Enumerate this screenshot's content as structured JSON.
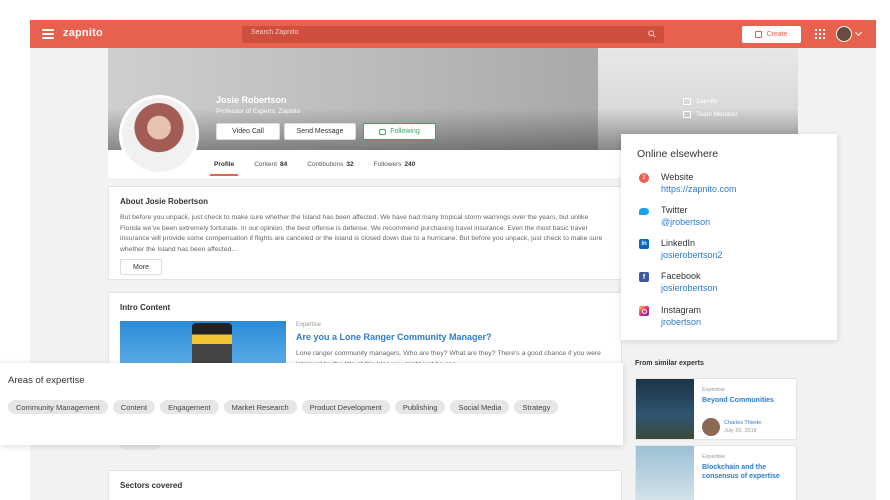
{
  "topbar": {
    "logo": "zapnito",
    "search_placeholder": "Search Zapnito",
    "create_label": "Create",
    "accent": "#e8614e"
  },
  "profile": {
    "name": "Josie Robertson",
    "title": "Professor of Experts, Zapnito",
    "buttons": {
      "video": "Video Call",
      "message": "Send Message",
      "following": "Following"
    },
    "side_info": [
      "Zapnito",
      "Team Member"
    ]
  },
  "tabs": [
    {
      "label": "Profile",
      "count": ""
    },
    {
      "label": "Content",
      "count": "84"
    },
    {
      "label": "Contibutions",
      "count": "32"
    },
    {
      "label": "Followers",
      "count": "240"
    }
  ],
  "about": {
    "title": "About Josie Robertson",
    "text": "But before you unpack, just check to make sure whether the Island has been affected. We have had many tropical storm warnings over the years, but unlike Florida we’ve been extremely fortunate. In our opinion, the best offense is defense. We recommend purchasing travel insurance. Even the most basic travel insurance will provide some compensation if flights are canceled or the island is closed down due to a hurricane. But before you unpack, just check to make sure whether the Island has been affected…",
    "more_label": "More"
  },
  "intro": {
    "title": "Intro Content",
    "kicker": "Expertise",
    "headline": "Are you a Lone Ranger Community Manager?",
    "text": "Lone ranger community managers. Who are they? What are they? There's a good chance if you were intrigued by the title of this blog you might just be one..."
  },
  "sectors": {
    "title": "Sectors covered"
  },
  "similar": {
    "title": "From similar experts",
    "items": [
      {
        "kicker": "Expertise",
        "headline": "Beyond Communities",
        "author": "Charles Thiede",
        "date": "July 20, 2018"
      },
      {
        "kicker": "Expertise",
        "headline": "Blockchain and the consensus of expertise"
      }
    ]
  },
  "online": {
    "title": "Online elsewhere",
    "items": [
      {
        "name": "Website",
        "link": "https://zapnito.com",
        "icon": "globe-icon",
        "badge": "2"
      },
      {
        "name": "Twitter",
        "link": "@jrobertson",
        "icon": "twitter-icon"
      },
      {
        "name": "LinkedIn",
        "link": "josierobertson2",
        "icon": "linkedin-icon",
        "badge": "in"
      },
      {
        "name": "Facebook",
        "link": "josierobertson",
        "icon": "facebook-icon",
        "badge": "f"
      },
      {
        "name": "Instagram",
        "link": "jrobertson",
        "icon": "instagram-icon"
      }
    ]
  },
  "areas": {
    "title": "Areas of expertise",
    "chips": [
      "Community Management",
      "Content",
      "Engagement",
      "Market Research",
      "Product Development",
      "Publishing",
      "Social Media",
      "Strategy"
    ]
  }
}
